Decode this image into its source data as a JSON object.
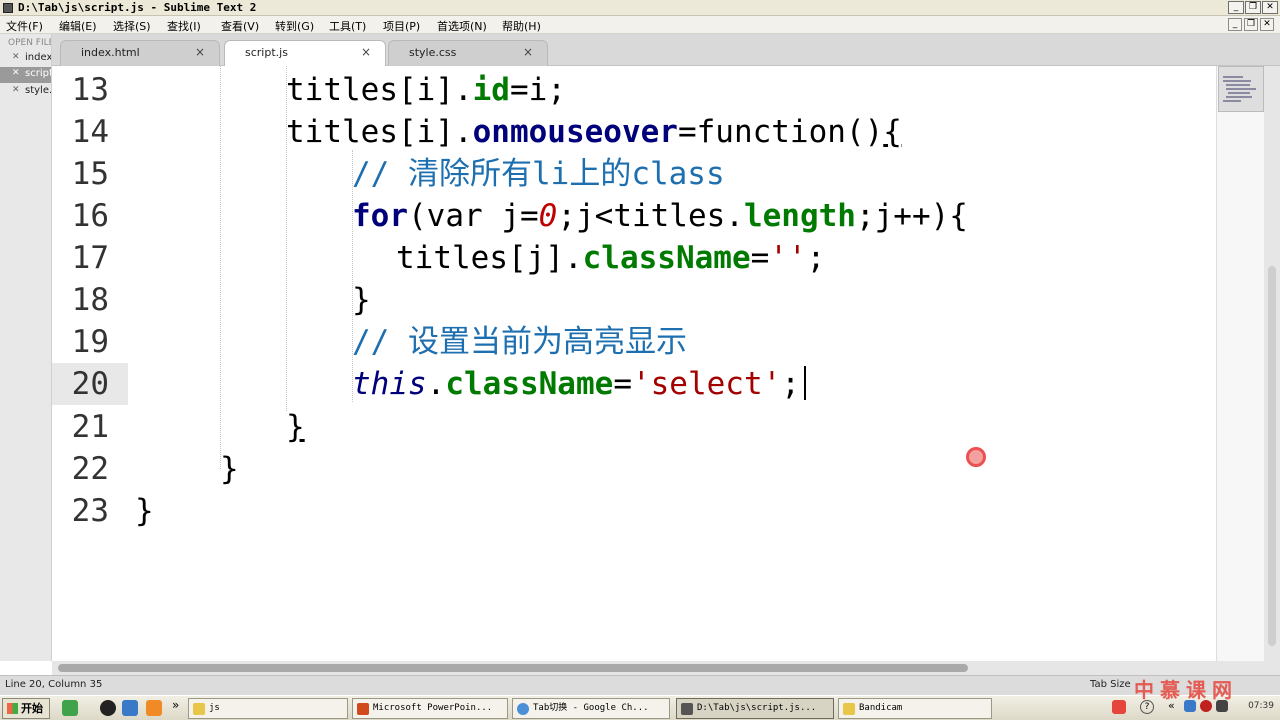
{
  "window": {
    "title": "D:\\Tab\\js\\script.js - Sublime Text 2",
    "buttons": [
      "_",
      "❐",
      "✕"
    ]
  },
  "menu": [
    "文件(F)",
    "编辑(E)",
    "选择(S)",
    "查找(I)",
    "查看(V)",
    "转到(G)",
    "工具(T)",
    "项目(P)",
    "首选项(N)",
    "帮助(H)"
  ],
  "sidebar": {
    "header": "OPEN FILES",
    "files": [
      {
        "name": "index.html",
        "active": false
      },
      {
        "name": "script.js",
        "active": true
      },
      {
        "name": "style.css",
        "active": false
      }
    ]
  },
  "tabs": [
    {
      "label": "index.html",
      "active": false
    },
    {
      "label": "script.js",
      "active": true
    },
    {
      "label": "style.css",
      "active": false
    }
  ],
  "editor": {
    "current_line": 20,
    "lines": [
      {
        "n": "13",
        "tokens": [
          {
            "t": "titles[i]."
          },
          {
            "t": "id",
            "c": "prop"
          },
          {
            "t": "=i;"
          }
        ]
      },
      {
        "n": "14",
        "tokens": [
          {
            "t": "titles[i]."
          },
          {
            "t": "onmouseover",
            "c": "kw"
          },
          {
            "t": "=function()"
          },
          {
            "t": "{",
            "c": "brk"
          }
        ]
      },
      {
        "n": "15",
        "tokens": [
          {
            "t": "// 清除所有li上的class",
            "c": "cm"
          }
        ]
      },
      {
        "n": "16",
        "tokens": [
          {
            "t": "for",
            "c": "kw"
          },
          {
            "t": "(var j="
          },
          {
            "t": "0",
            "c": "num"
          },
          {
            "t": ";j<titles."
          },
          {
            "t": "length",
            "c": "prop"
          },
          {
            "t": ";j++){"
          }
        ]
      },
      {
        "n": "17",
        "tokens": [
          {
            "t": "titles[j]."
          },
          {
            "t": "className",
            "c": "prop"
          },
          {
            "t": "="
          },
          {
            "t": "''",
            "c": "str"
          },
          {
            "t": ";"
          }
        ]
      },
      {
        "n": "18",
        "tokens": [
          {
            "t": "}"
          }
        ]
      },
      {
        "n": "19",
        "tokens": [
          {
            "t": "// 设置当前为高亮显示",
            "c": "cm"
          }
        ]
      },
      {
        "n": "20",
        "tokens": [
          {
            "t": "this",
            "c": "it"
          },
          {
            "t": "."
          },
          {
            "t": "className",
            "c": "prop"
          },
          {
            "t": "="
          },
          {
            "t": "'select'",
            "c": "str"
          },
          {
            "t": ";"
          }
        ],
        "caret": true
      },
      {
        "n": "21",
        "tokens": [
          {
            "t": "}",
            "c": "brk"
          }
        ]
      },
      {
        "n": "22",
        "tokens": [
          {
            "t": "}"
          }
        ]
      },
      {
        "n": "23",
        "tokens": [
          {
            "t": "}"
          }
        ]
      }
    ]
  },
  "status": {
    "position": "Line 20, Column 35",
    "tab_size": "Tab Size"
  },
  "taskbar": {
    "start_label": "开始",
    "overflow": "»",
    "tasks": [
      {
        "label": "js",
        "icon_color": "#e8c64a",
        "active": false
      },
      {
        "label": "Microsoft PowerPoin...",
        "icon_color": "#d04a1e",
        "active": false
      },
      {
        "label": "Tab切换 - Google Ch...",
        "icon_color": "#4a8fd8",
        "active": false
      },
      {
        "label": "D:\\Tab\\js\\script.js...",
        "icon_color": "#555555",
        "active": true
      },
      {
        "label": "Bandicam",
        "icon_color": "#e8c64a",
        "active": false
      }
    ],
    "tray_collapse": "«",
    "clock": "07:39"
  },
  "watermark": "中慕课网"
}
